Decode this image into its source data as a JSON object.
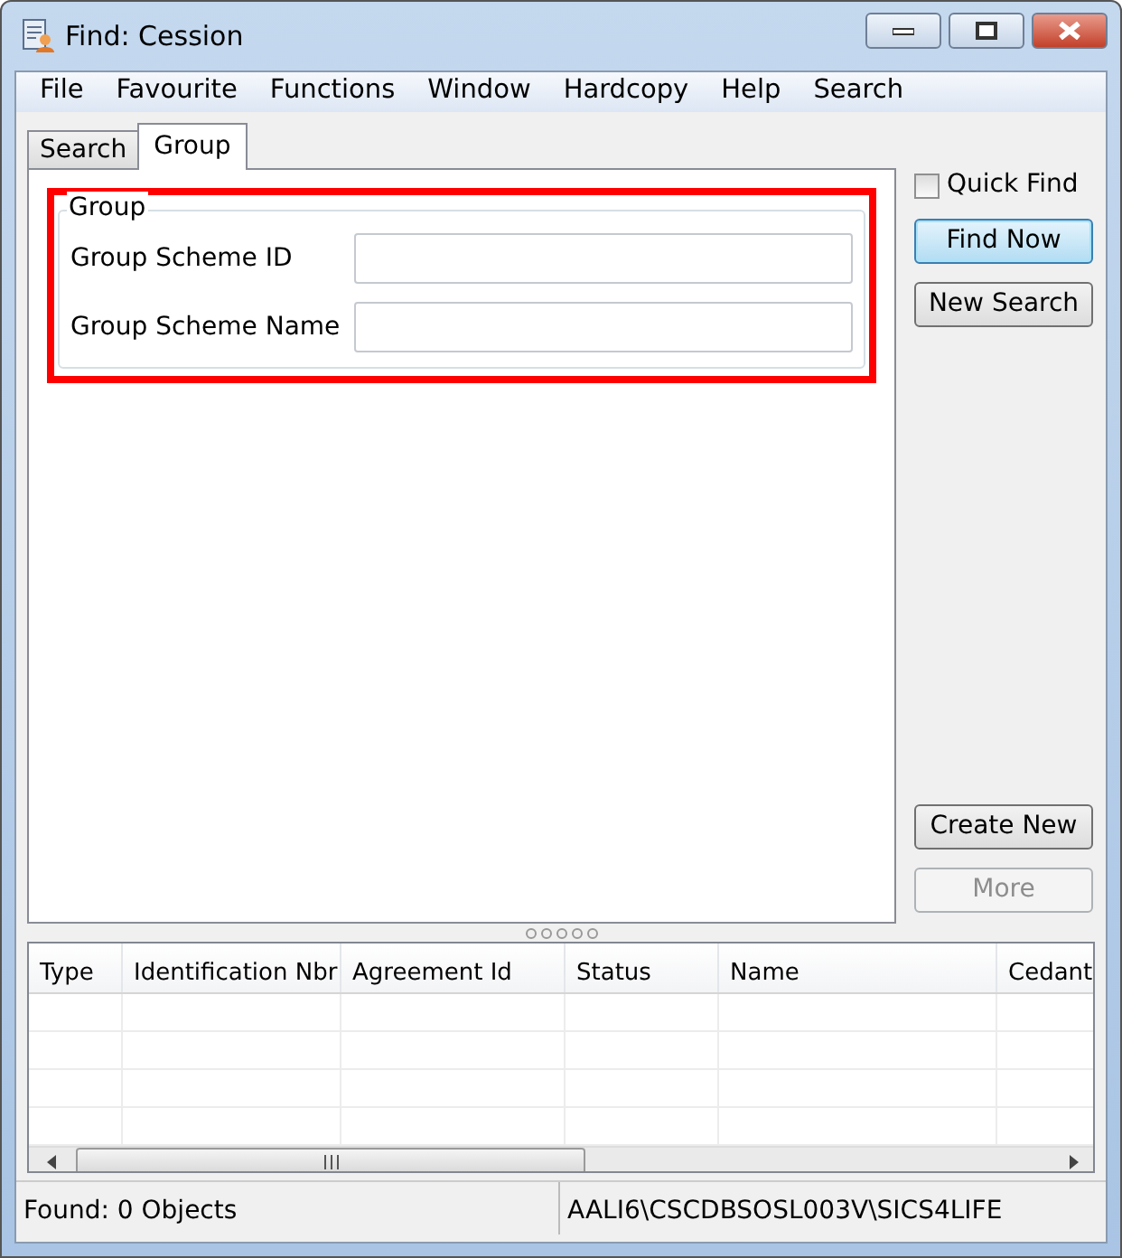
{
  "window": {
    "title": "Find: Cession"
  },
  "menu": [
    "File",
    "Favourite",
    "Functions",
    "Window",
    "Hardcopy",
    "Help",
    "Search"
  ],
  "tabs": [
    {
      "label": "Search",
      "selected": false
    },
    {
      "label": "Group",
      "selected": true
    }
  ],
  "group": {
    "title": "Group",
    "highlighted": true,
    "fields": [
      {
        "label": "Group Scheme ID"
      },
      {
        "label": "Group Scheme Name"
      }
    ]
  },
  "quick_find": {
    "label": "Quick Find",
    "checked": false
  },
  "top_buttons": [
    {
      "label": "Find Now",
      "default": true,
      "disabled": false
    },
    {
      "label": "New Search",
      "default": false,
      "disabled": false
    }
  ],
  "bottom_buttons": [
    {
      "label": "Create New",
      "default": false,
      "disabled": false
    },
    {
      "label": "More",
      "default": false,
      "disabled": true
    }
  ],
  "table": {
    "columns": [
      "Type",
      "Identification Nbr",
      "Agreement Id",
      "Status",
      "Name",
      "Cedant"
    ]
  },
  "status_bar": [
    "Found: 0 Objects",
    "AALI6\\CSCDBSOSL003V\\SICS4LIFE"
  ]
}
